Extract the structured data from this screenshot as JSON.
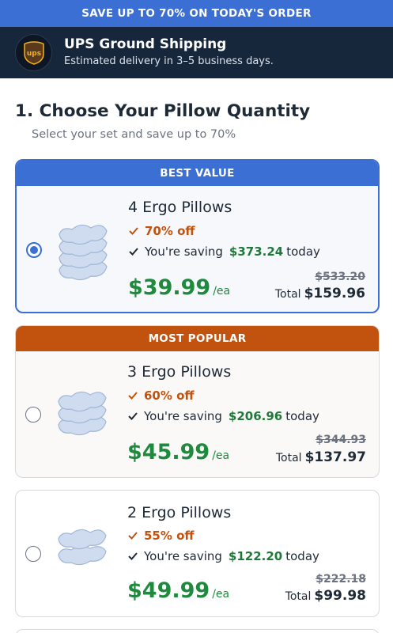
{
  "promo": {
    "text": "SAVE UP TO 70% ON TODAY'S ORDER"
  },
  "shipping": {
    "logo_text": "ups",
    "title": "UPS Ground Shipping",
    "subtitle": "Estimated delivery in 3–5 business days."
  },
  "section": {
    "title": "1. Choose Your Pillow Quantity",
    "subtitle": "Select your set and save up to 70%"
  },
  "options": [
    {
      "banner": "BEST VALUE",
      "title": "4 Ergo Pillows",
      "off": "70% off",
      "saving_prefix": "You're saving",
      "saving_amount": "$373.24",
      "saving_suffix": "today",
      "price": "$39.99",
      "per": "/ea",
      "old_price": "$533.20",
      "total_label": "Total",
      "total": "$159.96",
      "selected": true
    },
    {
      "banner": "MOST POPULAR",
      "title": "3 Ergo Pillows",
      "off": "60% off",
      "saving_prefix": "You're saving",
      "saving_amount": "$206.96",
      "saving_suffix": "today",
      "price": "$45.99",
      "per": "/ea",
      "old_price": "$344.93",
      "total_label": "Total",
      "total": "$137.97",
      "selected": false
    },
    {
      "title": "2 Ergo Pillows",
      "off": "55% off",
      "saving_prefix": "You're saving",
      "saving_amount": "$122.20",
      "saving_suffix": "today",
      "price": "$49.99",
      "per": "/ea",
      "old_price": "$222.18",
      "total_label": "Total",
      "total": "$99.98",
      "selected": false
    }
  ],
  "colors": {
    "accent_blue": "#3b6fd4",
    "accent_orange": "#c2530e",
    "price_green": "#1f8a3e",
    "dark_bar": "#16263b"
  }
}
